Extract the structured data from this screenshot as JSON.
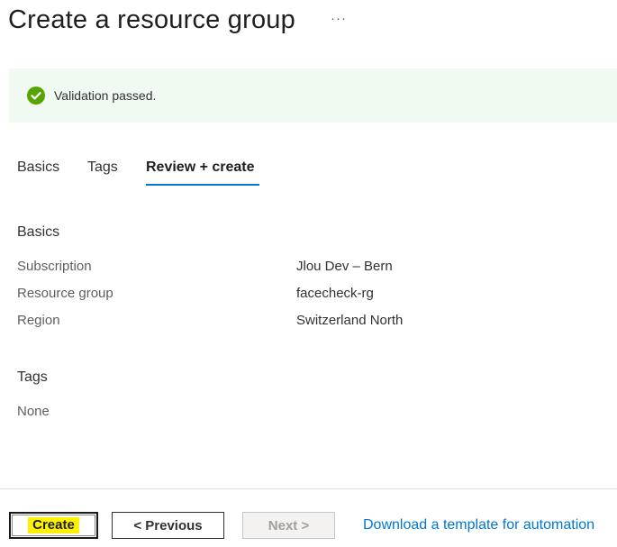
{
  "header": {
    "title": "Create a resource group",
    "more": "···"
  },
  "validation": {
    "message": "Validation passed.",
    "status_color": "#57a300",
    "icon": "check-circle-icon"
  },
  "tabs": [
    {
      "label": "Basics",
      "active": false
    },
    {
      "label": "Tags",
      "active": false
    },
    {
      "label": "Review + create",
      "active": true
    }
  ],
  "review": {
    "basics_heading": "Basics",
    "fields": [
      {
        "label": "Subscription",
        "value": "Jlou Dev – Bern"
      },
      {
        "label": "Resource group",
        "value": "facecheck-rg"
      },
      {
        "label": "Region",
        "value": "Switzerland North"
      }
    ],
    "tags_heading": "Tags",
    "tags_value": "None"
  },
  "footer": {
    "create_label": "Create",
    "previous_label": "< Previous",
    "next_label": "Next >",
    "download_link": "Download a template for automation"
  },
  "colors": {
    "accent": "#0078d4",
    "banner_bg": "#f1faf0",
    "highlight": "#fff200"
  }
}
